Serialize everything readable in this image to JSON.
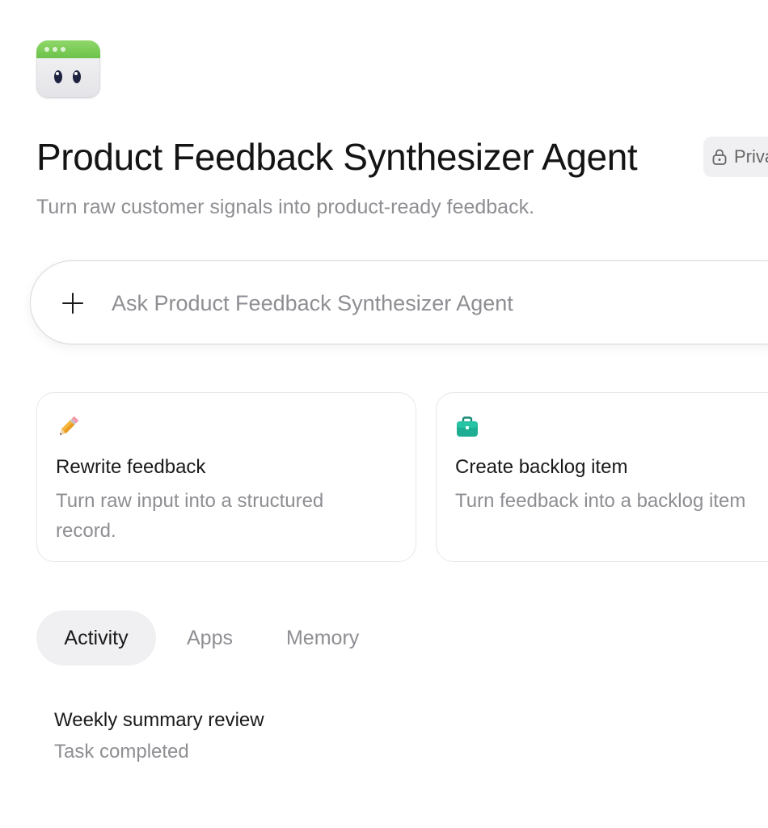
{
  "agent": {
    "title": "Product Feedback Synthesizer Agent",
    "privacy_label": "Private",
    "subtitle": "Turn raw customer signals into product-ready feedback.",
    "icon": "robot-window-icon"
  },
  "ask": {
    "placeholder": "Ask Product Feedback Synthesizer Agent",
    "value": "",
    "add_icon": "plus-icon"
  },
  "suggestions": [
    {
      "icon": "pencil-icon",
      "title": "Rewrite feedback",
      "description": "Turn raw input into a structured record."
    },
    {
      "icon": "briefcase-icon",
      "title": "Create backlog item",
      "description": "Turn feedback into a backlog item"
    }
  ],
  "tabs": [
    {
      "label": "Activity",
      "active": true
    },
    {
      "label": "Apps",
      "active": false
    },
    {
      "label": "Memory",
      "active": false
    }
  ],
  "activity": [
    {
      "title": "Weekly summary review",
      "status": "Task completed"
    }
  ],
  "colors": {
    "accent_green": "#6cc24a",
    "briefcase_teal": "#1fae94",
    "muted_text": "#8e8e93"
  }
}
